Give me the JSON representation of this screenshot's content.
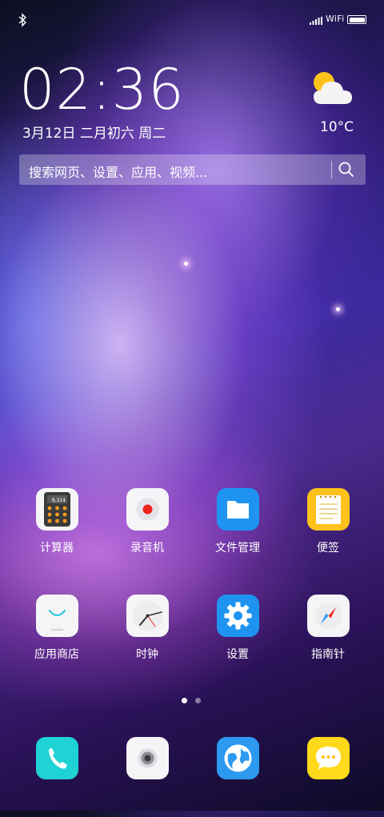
{
  "status_bar": {
    "bluetooth_icon": "bluetooth-icon",
    "signal_icon": "signal-icon",
    "wifi_label": "WiFi",
    "battery_icon": "battery-icon"
  },
  "clock": {
    "time": "02:36",
    "date": "3月12日 二月初六 周二"
  },
  "weather": {
    "icon": "partly-cloudy-icon",
    "temperature": "10°C"
  },
  "search": {
    "placeholder": "搜索网页、设置、应用、视频...",
    "icon": "search-icon"
  },
  "apps_row1": [
    {
      "label": "计算器",
      "icon": "calculator-icon",
      "display": "8,314"
    },
    {
      "label": "录音机",
      "icon": "recorder-icon"
    },
    {
      "label": "文件管理",
      "icon": "folder-icon"
    },
    {
      "label": "便签",
      "icon": "notepad-icon"
    }
  ],
  "apps_row2": [
    {
      "label": "应用商店",
      "icon": "app-store-icon"
    },
    {
      "label": "时钟",
      "icon": "clock-icon"
    },
    {
      "label": "设置",
      "icon": "settings-icon"
    },
    {
      "label": "指南针",
      "icon": "compass-icon"
    }
  ],
  "page_indicator": {
    "pages": 2,
    "current": 1
  },
  "dock": [
    {
      "icon": "phone-icon",
      "color": "#1fd2d4"
    },
    {
      "icon": "camera-icon",
      "color": "#f5f5f7"
    },
    {
      "icon": "browser-icon",
      "color": "#2d9af0"
    },
    {
      "icon": "messages-icon",
      "color": "#ffd91a"
    }
  ],
  "colors": {
    "accent_blue": "#2196f3",
    "note_yellow": "#ffc21a"
  }
}
